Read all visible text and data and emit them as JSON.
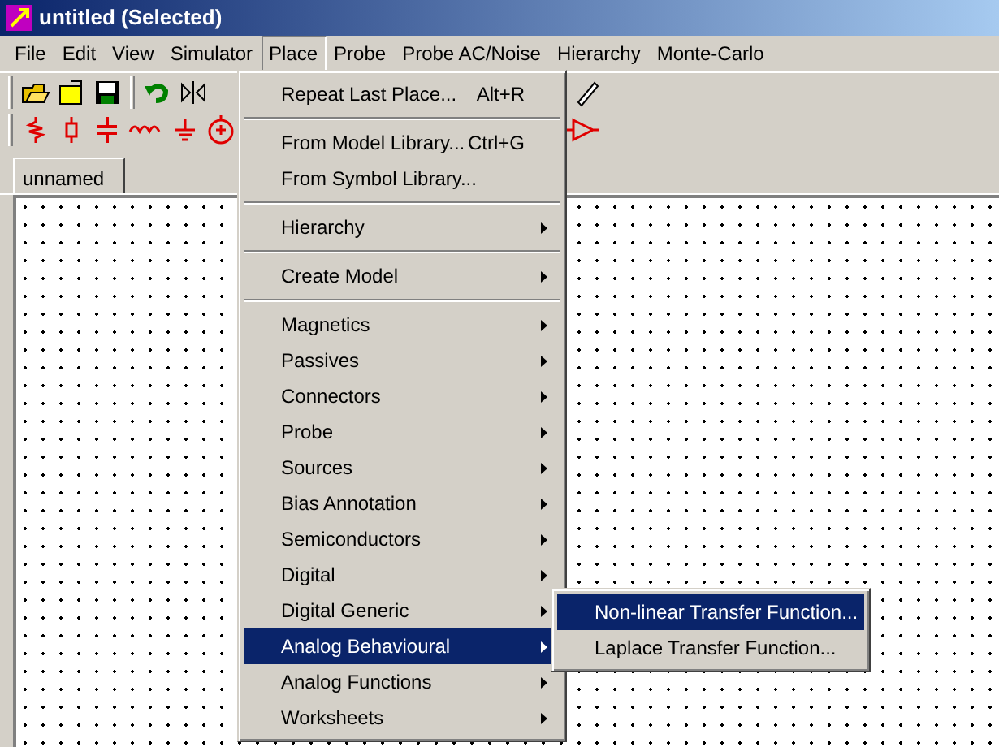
{
  "window": {
    "title": "untitled (Selected)"
  },
  "menubar": [
    {
      "label": "File",
      "selected": false
    },
    {
      "label": "Edit",
      "selected": false
    },
    {
      "label": "View",
      "selected": false
    },
    {
      "label": "Simulator",
      "selected": false
    },
    {
      "label": "Place",
      "selected": true
    },
    {
      "label": "Probe",
      "selected": false
    },
    {
      "label": "Probe AC/Noise",
      "selected": false
    },
    {
      "label": "Hierarchy",
      "selected": false
    },
    {
      "label": "Monte-Carlo",
      "selected": false
    }
  ],
  "document_tab": {
    "label": "unnamed"
  },
  "place_menu": [
    {
      "kind": "item",
      "label": "Repeat Last Place...",
      "shortcut": "Alt+R",
      "submenu": false,
      "selected": false
    },
    {
      "kind": "separator"
    },
    {
      "kind": "item",
      "label": "From Model Library...",
      "shortcut": "Ctrl+G",
      "submenu": false,
      "selected": false
    },
    {
      "kind": "item",
      "label": "From Symbol Library...",
      "submenu": false,
      "selected": false
    },
    {
      "kind": "separator"
    },
    {
      "kind": "item",
      "label": "Hierarchy",
      "submenu": true,
      "selected": false
    },
    {
      "kind": "separator"
    },
    {
      "kind": "item",
      "label": "Create Model",
      "submenu": true,
      "selected": false
    },
    {
      "kind": "separator"
    },
    {
      "kind": "item",
      "label": "Magnetics",
      "submenu": true,
      "selected": false
    },
    {
      "kind": "item",
      "label": "Passives",
      "submenu": true,
      "selected": false
    },
    {
      "kind": "item",
      "label": "Connectors",
      "submenu": true,
      "selected": false
    },
    {
      "kind": "item",
      "label": "Probe",
      "submenu": true,
      "selected": false
    },
    {
      "kind": "item",
      "label": "Sources",
      "submenu": true,
      "selected": false
    },
    {
      "kind": "item",
      "label": "Bias Annotation",
      "submenu": true,
      "selected": false
    },
    {
      "kind": "item",
      "label": "Semiconductors",
      "submenu": true,
      "selected": false
    },
    {
      "kind": "item",
      "label": "Digital",
      "submenu": true,
      "selected": false
    },
    {
      "kind": "item",
      "label": "Digital Generic",
      "submenu": true,
      "selected": false
    },
    {
      "kind": "item",
      "label": "Analog Behavioural",
      "submenu": true,
      "selected": true
    },
    {
      "kind": "item",
      "label": "Analog Functions",
      "submenu": true,
      "selected": false
    },
    {
      "kind": "item",
      "label": "Worksheets",
      "submenu": true,
      "selected": false
    }
  ],
  "submenu": [
    {
      "label": "Non-linear Transfer Function...",
      "selected": true
    },
    {
      "label": "Laplace Transfer Function...",
      "selected": false
    }
  ]
}
